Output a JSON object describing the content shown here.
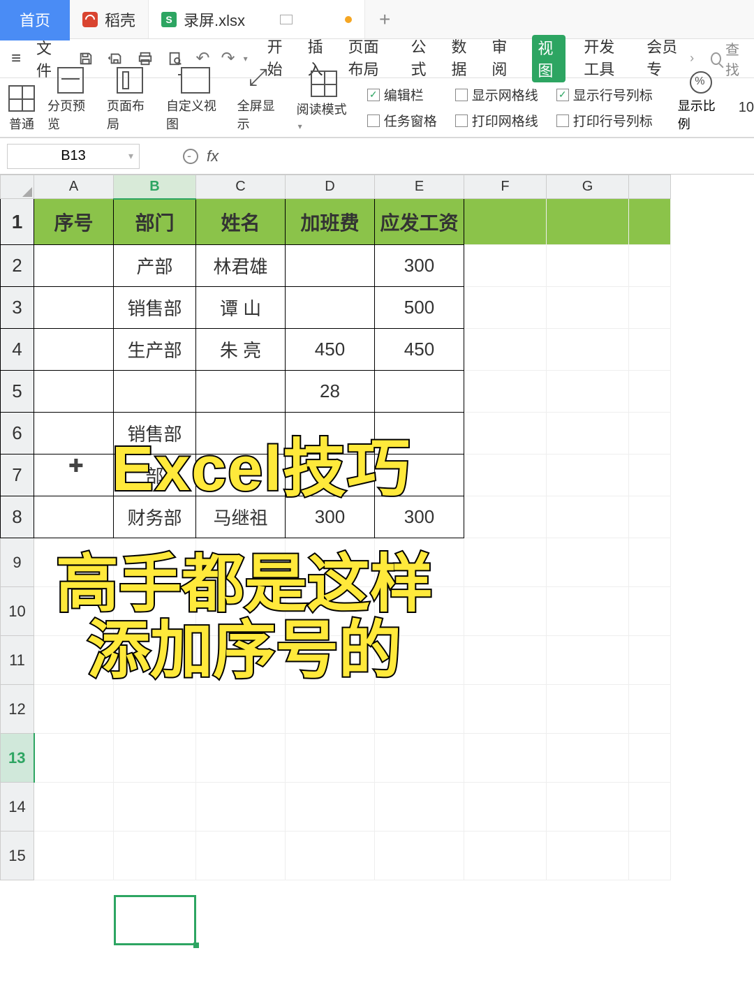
{
  "tabs": {
    "home": "首页",
    "dao": "稻壳",
    "file": "录屏.xlsx",
    "add": "+"
  },
  "toolbar1": {
    "file": "文件",
    "menu": [
      "开始",
      "插入",
      "页面布局",
      "公式",
      "数据",
      "审阅",
      "视图",
      "开发工具",
      "会员专"
    ],
    "search": "查找"
  },
  "ribbon": {
    "normal": "普通",
    "pagebreak": "分页预览",
    "pagelayout": "页面布局",
    "custom": "自定义视图",
    "fullscreen": "全屏显示",
    "readmode": "阅读模式",
    "formula_bar": "编辑栏",
    "gridlines": "显示网格线",
    "headings": "显示行号列标",
    "task_pane": "任务窗格",
    "print_grid": "打印网格线",
    "print_head": "打印行号列标",
    "zoom": "显示比例",
    "zoom_val": "10"
  },
  "fbar": {
    "name": "B13",
    "fx": "fx"
  },
  "cols": [
    "A",
    "B",
    "C",
    "D",
    "E",
    "F",
    "G"
  ],
  "rows": [
    "1",
    "2",
    "3",
    "4",
    "5",
    "6",
    "7",
    "8",
    "9",
    "10",
    "11",
    "12",
    "13",
    "14",
    "15"
  ],
  "headers": [
    "序号",
    "部门",
    "姓名",
    "加班费",
    "应发工资"
  ],
  "data": [
    [
      "",
      "产部",
      "林君雄",
      "",
      "300"
    ],
    [
      "",
      "销售部",
      "谭  山",
      "",
      "500"
    ],
    [
      "",
      "生产部",
      "朱  亮",
      "450",
      "450"
    ],
    [
      "",
      "",
      "",
      "28",
      ""
    ],
    [
      "",
      "销售部",
      "",
      "",
      ""
    ],
    [
      "",
      "部",
      "",
      "",
      ""
    ],
    [
      "",
      "财务部",
      "马继祖",
      "300",
      "300"
    ]
  ],
  "overlay": {
    "line1": "Excel技巧",
    "line2": "高手都是这样",
    "line3": "添加序号的"
  }
}
